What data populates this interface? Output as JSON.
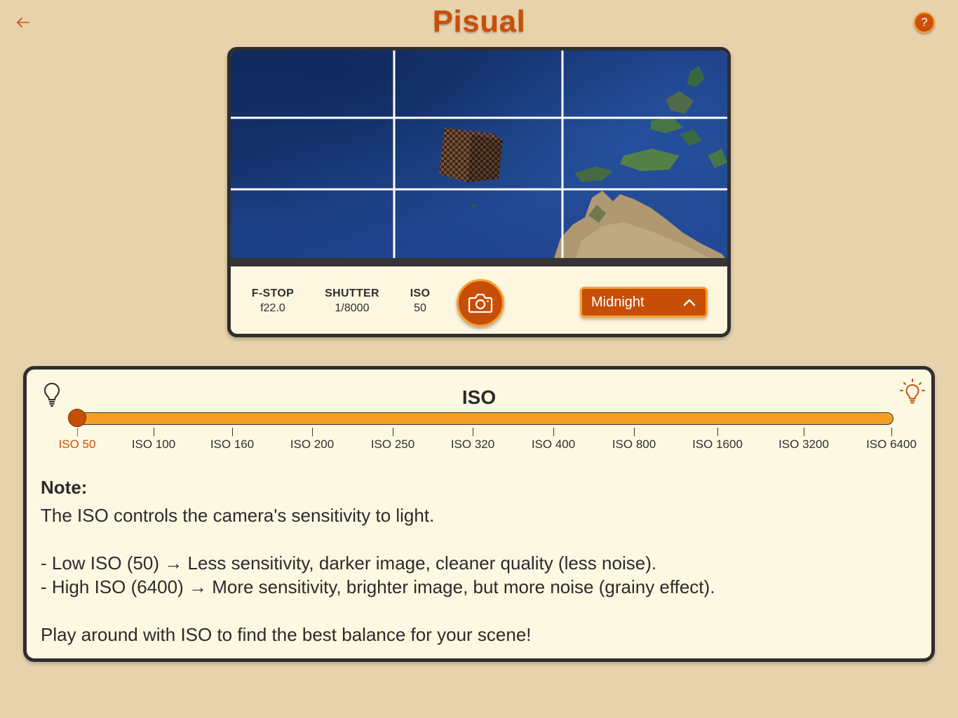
{
  "header": {
    "title": "Pisual",
    "help_label": "?"
  },
  "camera": {
    "settings": [
      {
        "label": "F-STOP",
        "value": "f22.0"
      },
      {
        "label": "SHUTTER",
        "value": "1/8000"
      },
      {
        "label": "ISO",
        "value": "50"
      }
    ],
    "preset": {
      "selected": "Midnight"
    }
  },
  "panel": {
    "title": "ISO",
    "slider": {
      "stops": [
        "ISO 50",
        "ISO 100",
        "ISO 160",
        "ISO 200",
        "ISO 250",
        "ISO 320",
        "ISO 400",
        "ISO 800",
        "ISO 1600",
        "ISO 3200",
        "ISO 6400"
      ],
      "selected_index": 0
    },
    "note": {
      "heading": "Note:",
      "line1": "The ISO controls the camera's sensitivity to light.",
      "line2": "- Low ISO (50) → Less sensitivity, darker image, cleaner quality (less noise).",
      "line3": "- High ISO (6400) → More sensitivity, brighter image, but more noise (grainy effect).",
      "line4": "Play around with ISO to find the best balance for your scene!"
    }
  },
  "colors": {
    "accent": "#c74e06",
    "accent_light": "#f59f24",
    "background": "#e7d2ac",
    "panel": "#fdf8e2"
  }
}
